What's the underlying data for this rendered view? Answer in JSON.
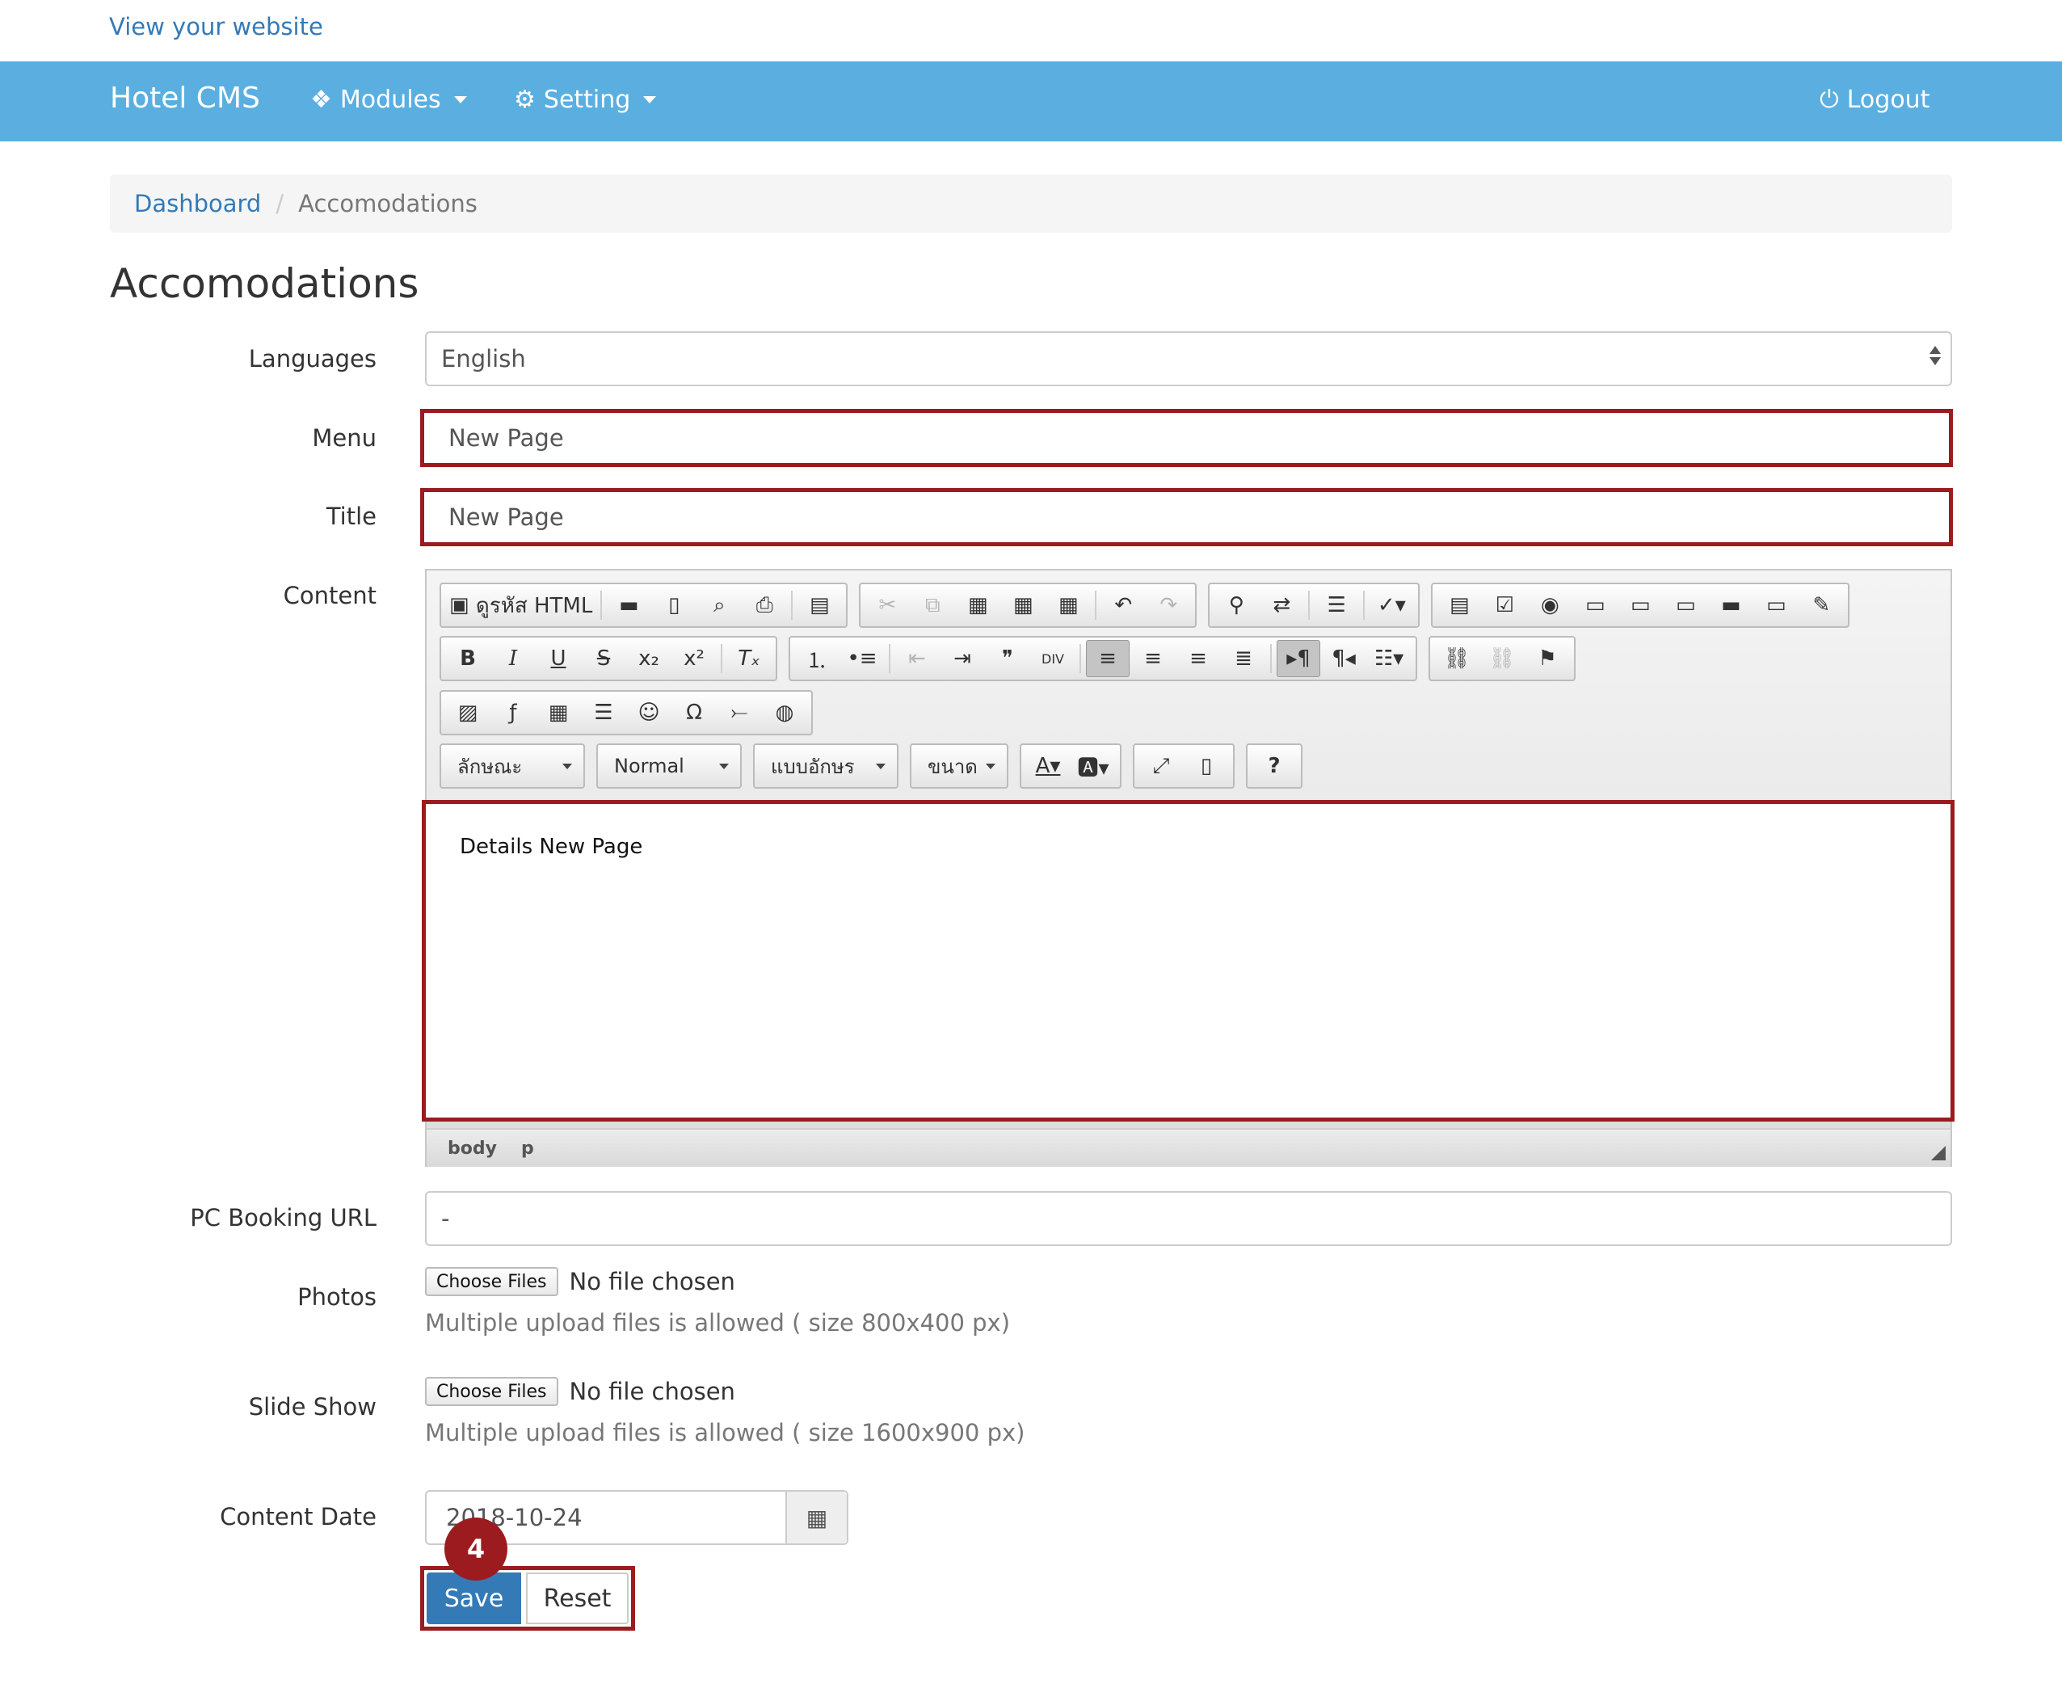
{
  "top_link": "View your website",
  "navbar": {
    "brand": "Hotel CMS",
    "modules_label": "Modules",
    "setting_label": "Setting",
    "logout_label": "Logout"
  },
  "breadcrumb": {
    "home": "Dashboard",
    "current": "Accomodations"
  },
  "page_title": "Accomodations",
  "form": {
    "languages_label": "Languages",
    "languages_value": "English",
    "menu_label": "Menu",
    "menu_value": "New Page",
    "title_label": "Title",
    "title_value": "New Page",
    "content_label": "Content",
    "editor": {
      "source_button": "ดูรหัส HTML",
      "combo_style": "ลักษณะ",
      "combo_format": "Normal",
      "combo_font": "แบบอักษร",
      "combo_size": "ขนาด",
      "content_text": "Details New Page",
      "path_body": "body",
      "path_p": "p"
    },
    "booking_label": "PC Booking URL",
    "booking_value": "-",
    "photos_label": "Photos",
    "photos_button": "Choose Files",
    "photos_status": "No file chosen",
    "photos_help": "Multiple upload files is allowed ( size 800x400 px)",
    "slideshow_label": "Slide Show",
    "slideshow_button": "Choose Files",
    "slideshow_status": "No file chosen",
    "slideshow_help": "Multiple upload files is allowed ( size 1600x900 px)",
    "date_label": "Content Date",
    "date_value": "2018-10-24",
    "save_label": "Save",
    "reset_label": "Reset",
    "step_badge": "4"
  },
  "colors": {
    "navbar": "#5aafe0",
    "highlight": "#9b1b1f",
    "primary": "#337ab7"
  }
}
